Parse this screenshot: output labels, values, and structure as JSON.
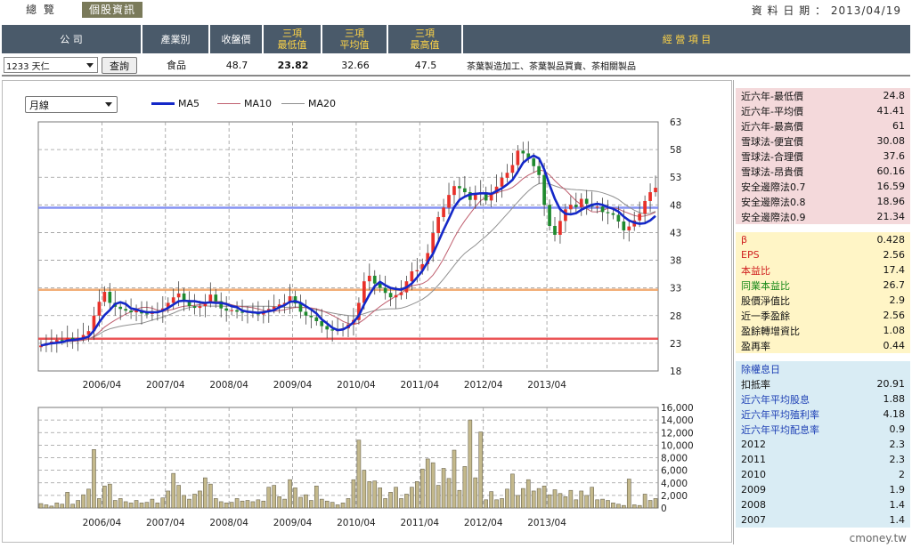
{
  "top": {
    "tab_overview": "總 覽",
    "tab_stock": "個股資訊",
    "date_label": "資 料 日 期 ：",
    "date_value": "2013/04/19"
  },
  "header": {
    "company": "公 司",
    "industry": "產業別",
    "close": "收盤價",
    "low_l1": "三項",
    "low_l2": "最低值",
    "avg_l1": "三項",
    "avg_l2": "平均值",
    "high_l1": "三項",
    "high_l2": "最高值",
    "business": "經 營 項 目"
  },
  "row": {
    "stock_select": "1233 天仁",
    "query_button": "查詢",
    "industry": "食品",
    "close": "48.7",
    "low": "23.82",
    "avg": "32.66",
    "high": "47.5",
    "business": "茶葉製造加工、茶葉製品買賣、茶相關製品"
  },
  "controls": {
    "period_select": "月線"
  },
  "colors": {
    "up": "#e8312a",
    "down": "#1f8a2e",
    "ma5": "#1428c8",
    "ma10": "#c06070",
    "ma20": "#909090",
    "line_low": "#e8383a",
    "line_avg": "#f0a060",
    "line_high": "#7080f0",
    "volume": "#c4b98c"
  },
  "chart_data": [
    {
      "type": "candlestick",
      "legend": [
        "MA5",
        "MA10",
        "MA20"
      ],
      "x_ticks": [
        "2006/04",
        "2007/04",
        "2008/04",
        "2009/04",
        "2010/04",
        "2011/04",
        "2012/04",
        "2013/04"
      ],
      "y_ticks": [
        63,
        58,
        53,
        48,
        43,
        38,
        33,
        28,
        23,
        18
      ],
      "ylim": [
        18,
        63
      ],
      "grid": true,
      "horizontal_lines": [
        23.82,
        32.66,
        47.5
      ],
      "x_start": "2005/04",
      "close": [
        22.6,
        23.0,
        23.3,
        23.6,
        23.5,
        24.0,
        23.6,
        24.0,
        24.5,
        25.2,
        28.0,
        30.5,
        32.3,
        30.3,
        29.6,
        29.2,
        28.9,
        28.6,
        29.0,
        28.4,
        28.3,
        28.8,
        28.7,
        29.3,
        30.3,
        31.3,
        32.0,
        30.8,
        29.7,
        29.4,
        29.7,
        30.3,
        31.8,
        30.6,
        29.3,
        28.9,
        29.0,
        28.7,
        28.6,
        28.7,
        28.4,
        28.2,
        28.7,
        29.2,
        29.6,
        30.0,
        30.3,
        31.5,
        30.2,
        28.7,
        28.0,
        27.7,
        27.0,
        26.1,
        25.5,
        25.3,
        25.4,
        25.7,
        26.4,
        27.2,
        30.3,
        34.2,
        35.2,
        33.8,
        33.0,
        32.1,
        31.3,
        31.7,
        32.2,
        34.2,
        36.0,
        36.2,
        37.3,
        39.3,
        42.9,
        45.8,
        47.5,
        49.8,
        51.4,
        51.0,
        50.3,
        48.9,
        49.9,
        50.3,
        48.8,
        50.1,
        51.3,
        52.9,
        53.8,
        55.2,
        57.8,
        57.3,
        56.4,
        55.0,
        53.4,
        48.0,
        44.2,
        42.6,
        45.1,
        47.2,
        48.0,
        47.6,
        49.1,
        48.2,
        47.7,
        47.7,
        46.7,
        46.5,
        46.2,
        45.0,
        43.4,
        44.1,
        45.2,
        46.4,
        48.7,
        50.3,
        51.1
      ],
      "ma5": [
        22.6,
        22.8,
        23.0,
        23.1,
        23.2,
        23.5,
        23.6,
        23.7,
        23.9,
        24.2,
        25.3,
        26.8,
        28.1,
        29.0,
        30.1,
        30.4,
        30.1,
        29.3,
        29.1,
        28.8,
        28.6,
        28.6,
        28.6,
        28.9,
        29.4,
        30.0,
        30.6,
        30.7,
        30.6,
        30.6,
        30.4,
        30.3,
        30.4,
        30.3,
        30.3,
        30.1,
        29.7,
        29.5,
        28.9,
        28.7,
        28.6,
        28.5,
        28.6,
        28.8,
        29.0,
        29.5,
        29.9,
        30.5,
        30.6,
        30.3,
        29.7,
        29.1,
        28.4,
        27.3,
        26.6,
        25.8,
        25.4,
        25.5,
        26.0,
        26.8,
        28.0,
        30.0,
        31.8,
        33.3,
        34.1,
        33.5,
        33.0,
        32.8,
        32.7,
        33.1,
        33.8,
        34.9,
        36.1,
        37.7,
        39.2,
        41.3,
        43.5,
        45.5,
        47.6,
        48.9,
        49.5,
        49.9,
        50.0,
        50.1,
        50.1,
        50.0,
        50.5,
        51.0,
        51.7,
        52.5,
        54.0,
        55.6,
        56.4,
        56.9,
        56.4,
        54.4,
        51.6,
        49.1,
        47.2,
        46.4,
        46.3,
        46.5,
        47.1,
        47.6,
        48.0,
        48.2,
        48.0,
        47.6,
        47.3,
        46.8,
        45.9,
        45.2,
        44.8,
        44.6,
        44.7,
        45.2,
        46.0
      ]
    },
    {
      "type": "bar",
      "title": "",
      "x_ticks": [
        "2006/04",
        "2007/04",
        "2008/04",
        "2009/04",
        "2010/04",
        "2011/04",
        "2012/04",
        "2013/04"
      ],
      "y_ticks": [
        0,
        2000,
        4000,
        6000,
        8000,
        10000,
        12000,
        14000,
        16000
      ],
      "ylim": [
        0,
        16000
      ],
      "values": [
        700,
        500,
        300,
        800,
        600,
        2500,
        600,
        1200,
        2100,
        3000,
        9300,
        1500,
        3500,
        3800,
        1200,
        1500,
        1000,
        800,
        1200,
        800,
        900,
        1400,
        800,
        1600,
        2700,
        5500,
        3600,
        2000,
        1400,
        2200,
        2700,
        4800,
        3800,
        1500,
        1000,
        800,
        900,
        1500,
        1100,
        1200,
        1000,
        1300,
        1100,
        3300,
        3600,
        1800,
        1400,
        4500,
        3200,
        1700,
        2100,
        1200,
        3500,
        1400,
        1100,
        900,
        500,
        800,
        1500,
        4500,
        10800,
        6000,
        4200,
        4300,
        3200,
        1500,
        2500,
        3300,
        1500,
        2200,
        3300,
        4200,
        6200,
        7800,
        7200,
        3600,
        6300,
        4700,
        9200,
        2800,
        6600,
        14000,
        4800,
        12100,
        1300,
        2600,
        1300,
        1500,
        3000,
        5400,
        2000,
        3100,
        4500,
        2700,
        3100,
        3500,
        2100,
        2900,
        2300,
        1800,
        2800,
        1300,
        2700,
        2000,
        3300,
        1300,
        1400,
        1200,
        800,
        600,
        400,
        4600,
        500,
        400,
        2200,
        1200,
        1500
      ]
    }
  ],
  "side": {
    "group1": [
      {
        "k": "近六年-最低價",
        "v": "24.8"
      },
      {
        "k": "近六年-平均價",
        "v": "41.41"
      },
      {
        "k": "近六年-最高價",
        "v": "61"
      },
      {
        "k": "雪球法-便宜價",
        "v": "30.08"
      },
      {
        "k": "雪球法-合理價",
        "v": "37.6"
      },
      {
        "k": "雪球法-昂貴價",
        "v": "60.16"
      },
      {
        "k": "安全邊際法0.7",
        "v": "16.59"
      },
      {
        "k": "安全邊際法0.8",
        "v": "18.96"
      },
      {
        "k": "安全邊際法0.9",
        "v": "21.34"
      }
    ],
    "group2": [
      {
        "k": "β",
        "v": "0.428"
      },
      {
        "k": "EPS",
        "v": "2.56"
      },
      {
        "k": "本益比",
        "v": "17.4"
      },
      {
        "k": "同業本益比",
        "v": "26.7"
      },
      {
        "k": "股價淨值比",
        "v": "2.9"
      },
      {
        "k": "近一季盈餘",
        "v": "2.56"
      },
      {
        "k": "盈餘轉增資比",
        "v": "1.08"
      },
      {
        "k": "盈再率",
        "v": "0.44"
      }
    ],
    "group3_title": "除權息日",
    "group3": [
      {
        "k": "扣抵率",
        "v": "20.91"
      },
      {
        "k": "近六年平均股息",
        "v": "1.88"
      },
      {
        "k": "近六年平均殖利率",
        "v": "4.18"
      },
      {
        "k": "近六年平均配息率",
        "v": "0.9"
      },
      {
        "k": "2012",
        "v": "2.3"
      },
      {
        "k": "2011",
        "v": "2.3"
      },
      {
        "k": "2010",
        "v": "2"
      },
      {
        "k": "2009",
        "v": "1.9"
      },
      {
        "k": "2008",
        "v": "1.4"
      },
      {
        "k": "2007",
        "v": "1.4"
      }
    ]
  },
  "watermark": "cmoney.tw"
}
